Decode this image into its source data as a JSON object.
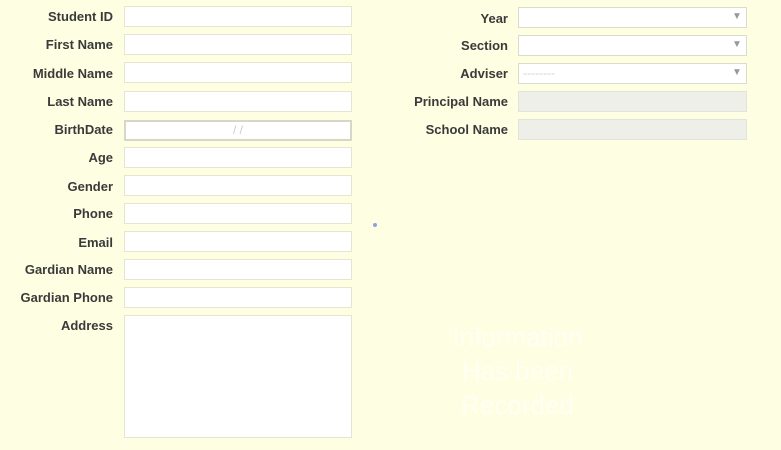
{
  "left_form": {
    "student_id": {
      "label": "Student ID",
      "value": ""
    },
    "first_name": {
      "label": "First Name",
      "value": ""
    },
    "middle_name": {
      "label": "Middle Name",
      "value": ""
    },
    "last_name": {
      "label": "Last Name",
      "value": ""
    },
    "birthdate": {
      "label": "BirthDate",
      "value": "/  /"
    },
    "age": {
      "label": "Age",
      "value": ""
    },
    "gender": {
      "label": "Gender",
      "value": ""
    },
    "phone": {
      "label": "Phone",
      "value": ""
    },
    "email": {
      "label": "Email",
      "value": ""
    },
    "guardian_name": {
      "label": "Gardian Name",
      "value": ""
    },
    "guardian_phone": {
      "label": "Gardian Phone",
      "value": ""
    },
    "address": {
      "label": "Address",
      "value": ""
    }
  },
  "right_form": {
    "year": {
      "label": "Year",
      "value": ""
    },
    "section": {
      "label": "Section",
      "value": ""
    },
    "adviser": {
      "label": "Adviser",
      "value": "--------"
    },
    "principal_name": {
      "label": "Principal Name",
      "value": ""
    },
    "school_name": {
      "label": "School Name",
      "value": ""
    }
  },
  "watermark": {
    "line1": "Information",
    "line2": "Has been",
    "line3": "Recorded"
  },
  "colors": {
    "background": "#fefee2",
    "label_text": "#3a3a3a",
    "field_bg": "#ffffff",
    "readonly_bg": "#efefe9"
  }
}
